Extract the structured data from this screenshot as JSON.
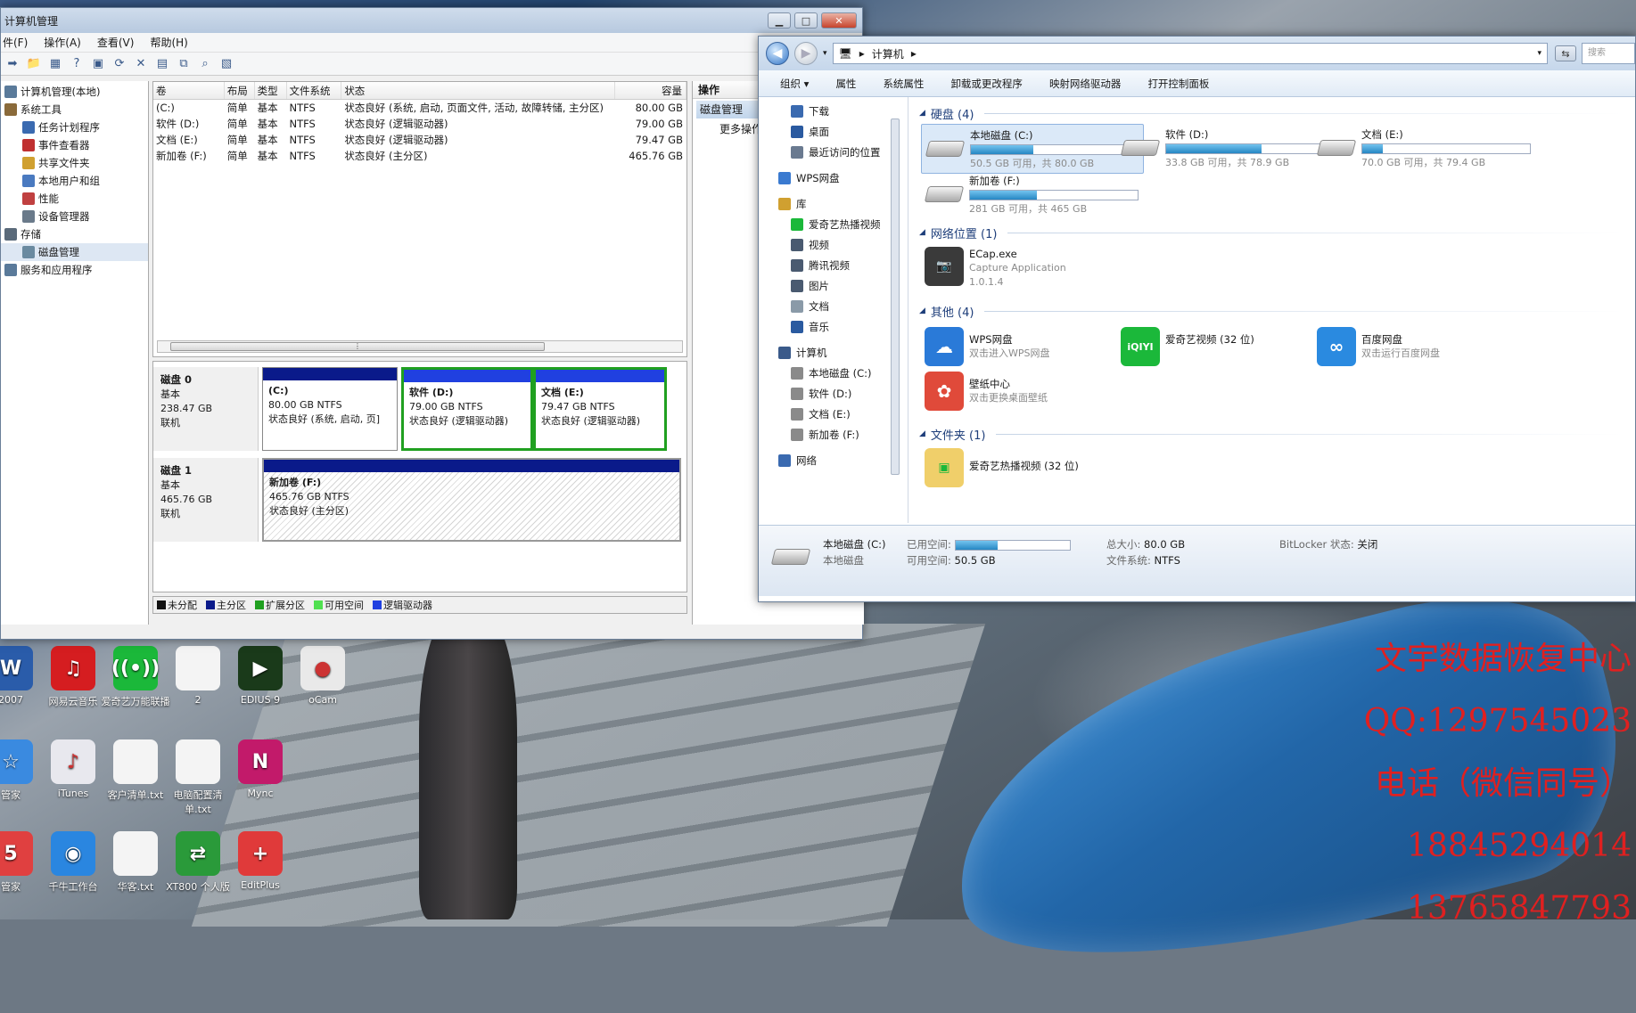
{
  "desktop": {
    "watermark": [
      "文宇数据恢复中心",
      "QQ:1297545023",
      "电话（微信同号）",
      "18845294014",
      "13765847793"
    ],
    "icons": [
      {
        "label": "2007",
        "icon": "word-icon",
        "color": "#2a5caa",
        "glyph": "W"
      },
      {
        "label": "网易云音乐",
        "icon": "netease-music-icon",
        "color": "#d51d20",
        "glyph": "♫"
      },
      {
        "label": "爱奇艺万能联播",
        "icon": "iqiyi-cast-icon",
        "color": "#1bb83a",
        "glyph": "((•))"
      },
      {
        "label": "2",
        "icon": "blank-file-icon",
        "color": "#f4f4f4",
        "glyph": ""
      },
      {
        "label": "EDIUS 9",
        "icon": "edius-icon",
        "color": "#1a3a1a",
        "glyph": "▶"
      },
      {
        "label": "oCam",
        "icon": "ocam-icon",
        "color": "#e9e9e9",
        "glyph": "●"
      },
      {
        "label": "管家",
        "icon": "manager-icon",
        "color": "#3a8ae0",
        "glyph": "☆"
      },
      {
        "label": "iTunes",
        "icon": "itunes-icon",
        "color": "#e8e8ee",
        "glyph": "♪"
      },
      {
        "label": "客户清单.txt",
        "icon": "txt-file-icon",
        "color": "#f4f4f4",
        "glyph": ""
      },
      {
        "label": "电脑配置清单.txt",
        "icon": "txt-file-icon",
        "color": "#f4f4f4",
        "glyph": ""
      },
      {
        "label": "Mync",
        "icon": "mync-icon",
        "color": "#c21a6a",
        "glyph": "N"
      },
      {
        "label": "管家",
        "icon": "tencent-manager-icon",
        "color": "#e04040",
        "glyph": "5"
      },
      {
        "label": "千牛工作台",
        "icon": "qianniu-icon",
        "color": "#2a86e0",
        "glyph": "◉"
      },
      {
        "label": "华客.txt",
        "icon": "txt-file-icon",
        "color": "#f4f4f4",
        "glyph": ""
      },
      {
        "label": "XT800 个人版",
        "icon": "xt800-icon",
        "color": "#2a9a3a",
        "glyph": "⇄"
      },
      {
        "label": "EditPlus",
        "icon": "editplus-icon",
        "color": "#e03a3a",
        "glyph": "+"
      }
    ]
  },
  "cm": {
    "title": "计算机管理",
    "menu": [
      "件(F)",
      "操作(A)",
      "查看(V)",
      "帮助(H)"
    ],
    "tree": [
      {
        "label": "计算机管理(本地)",
        "indent": 0
      },
      {
        "label": "系统工具",
        "indent": 0
      },
      {
        "label": "任务计划程序",
        "indent": 1
      },
      {
        "label": "事件查看器",
        "indent": 1
      },
      {
        "label": "共享文件夹",
        "indent": 1
      },
      {
        "label": "本地用户和组",
        "indent": 1
      },
      {
        "label": "性能",
        "indent": 1
      },
      {
        "label": "设备管理器",
        "indent": 1
      },
      {
        "label": "存储",
        "indent": 0
      },
      {
        "label": "磁盘管理",
        "indent": 1
      },
      {
        "label": "服务和应用程序",
        "indent": 0
      }
    ],
    "columns": [
      "卷",
      "布局",
      "类型",
      "文件系统",
      "状态",
      "容量"
    ],
    "volumes": [
      [
        "(C:)",
        "简单",
        "基本",
        "NTFS",
        "状态良好 (系统, 启动, 页面文件, 活动, 故障转储, 主分区)",
        "80.00 GB"
      ],
      [
        "软件 (D:)",
        "简单",
        "基本",
        "NTFS",
        "状态良好 (逻辑驱动器)",
        "79.00 GB"
      ],
      [
        "文档 (E:)",
        "简单",
        "基本",
        "NTFS",
        "状态良好 (逻辑驱动器)",
        "79.47 GB"
      ],
      [
        "新加卷 (F:)",
        "简单",
        "基本",
        "NTFS",
        "状态良好 (主分区)",
        "465.76 GB"
      ]
    ],
    "actions": {
      "header": "操作",
      "item": "磁盘管理",
      "more": "更多操作"
    },
    "disk0": {
      "name": "磁盘 0",
      "type": "基本",
      "size": "238.47 GB",
      "status": "联机",
      "parts": [
        {
          "name": "(C:)",
          "size": "80.00 GB NTFS",
          "status": "状态良好 (系统, 启动, 页]"
        },
        {
          "name": "软件  (D:)",
          "size": "79.00 GB NTFS",
          "status": "状态良好 (逻辑驱动器)"
        },
        {
          "name": "文档  (E:)",
          "size": "79.47 GB NTFS",
          "status": "状态良好 (逻辑驱动器)"
        }
      ]
    },
    "disk1": {
      "name": "磁盘 1",
      "type": "基本",
      "size": "465.76 GB",
      "status": "联机",
      "part": {
        "name": "新加卷  (F:)",
        "size": "465.76 GB NTFS",
        "status": "状态良好 (主分区)"
      }
    },
    "legend": [
      {
        "label": "未分配",
        "color": "#111111"
      },
      {
        "label": "主分区",
        "color": "#0a1a8a"
      },
      {
        "label": "扩展分区",
        "color": "#20a020"
      },
      {
        "label": "可用空间",
        "color": "#50e050"
      },
      {
        "label": "逻辑驱动器",
        "color": "#2040e0"
      }
    ]
  },
  "ex": {
    "path": "计算机",
    "search_placeholder": "搜索",
    "commands": [
      "组织 ▾",
      "属性",
      "系统属性",
      "卸载或更改程序",
      "映射网络驱动器",
      "打开控制面板"
    ],
    "nav": [
      {
        "label": "下载",
        "icon": "download-folder-icon",
        "color": "#3a6ab0",
        "grp": false
      },
      {
        "label": "桌面",
        "icon": "desktop-icon",
        "color": "#2a5aa0",
        "grp": false
      },
      {
        "label": "最近访问的位置",
        "icon": "recent-places-icon",
        "color": "#6a7a90",
        "grp": false
      },
      {
        "label": "WPS网盘",
        "icon": "wps-cloud-icon",
        "color": "#3a7ad0",
        "grp": true
      },
      {
        "label": "库",
        "icon": "library-icon",
        "color": "#d0a030",
        "grp": true
      },
      {
        "label": "爱奇艺热播视频",
        "icon": "iqiyi-icon",
        "color": "#1bb83a",
        "grp": false
      },
      {
        "label": "视频",
        "icon": "video-library-icon",
        "color": "#4a5a70",
        "grp": false
      },
      {
        "label": "腾讯视频",
        "icon": "tencent-video-icon",
        "color": "#4a5a70",
        "grp": false
      },
      {
        "label": "图片",
        "icon": "pictures-library-icon",
        "color": "#4a5a70",
        "grp": false
      },
      {
        "label": "文档",
        "icon": "documents-library-icon",
        "color": "#8a9aa8",
        "grp": false
      },
      {
        "label": "音乐",
        "icon": "music-library-icon",
        "color": "#2a5aa0",
        "grp": false
      },
      {
        "label": "计算机",
        "icon": "computer-icon",
        "color": "#3a5a8a",
        "grp": true
      },
      {
        "label": "本地磁盘 (C:)",
        "icon": "drive-c-icon",
        "color": "#8a8a8a",
        "grp": false
      },
      {
        "label": "软件 (D:)",
        "icon": "drive-icon",
        "color": "#8a8a8a",
        "grp": false
      },
      {
        "label": "文档 (E:)",
        "icon": "drive-icon",
        "color": "#8a8a8a",
        "grp": false
      },
      {
        "label": "新加卷 (F:)",
        "icon": "drive-icon",
        "color": "#8a8a8a",
        "grp": false
      },
      {
        "label": "网络",
        "icon": "network-icon",
        "color": "#3a6ab0",
        "grp": true
      }
    ],
    "sections": {
      "hard": "硬盘 (4)",
      "net": "网络位置 (1)",
      "other": "其他 (4)",
      "folder": "文件夹 (1)"
    },
    "drives": [
      {
        "name": "本地磁盘 (C:)",
        "free": "50.5 GB 可用，共 80.0 GB",
        "used_fraction": 0.37,
        "selected": true
      },
      {
        "name": "软件 (D:)",
        "free": "33.8 GB 可用，共 78.9 GB",
        "used_fraction": 0.57,
        "selected": false
      },
      {
        "name": "文档 (E:)",
        "free": "70.0 GB 可用，共 79.4 GB",
        "used_fraction": 0.12,
        "selected": false
      },
      {
        "name": "新加卷 (F:)",
        "free": "281 GB 可用，共 465 GB",
        "used_fraction": 0.4,
        "selected": false
      }
    ],
    "netloc": {
      "name": "ECap.exe",
      "desc": "Capture Application",
      "ver": "1.0.1.4"
    },
    "others": [
      {
        "name": "WPS网盘",
        "desc": "双击进入WPS网盘",
        "icon": "wps-cloud-icon",
        "color": "#2a7ad8",
        "glyph": "☁"
      },
      {
        "name": "爱奇艺视频 (32 位)",
        "desc": "",
        "icon": "iqiyi-icon",
        "color": "#1bb83a",
        "glyph": "iQIYI"
      },
      {
        "name": "百度网盘",
        "desc": "双击运行百度网盘",
        "icon": "baidu-netdisk-icon",
        "color": "#2a8ae0",
        "glyph": "∞"
      },
      {
        "name": "壁纸中心",
        "desc": "双击更换桌面壁纸",
        "icon": "wallpaper-center-icon",
        "color": "#e04a3a",
        "glyph": "✿"
      }
    ],
    "folder": {
      "name": "爱奇艺热播视频 (32 位)"
    },
    "details": {
      "name": "本地磁盘 (C:)",
      "kind": "本地磁盘",
      "used_label": "已用空间:",
      "used_fraction": 0.37,
      "free_label": "可用空间:",
      "free": "50.5 GB",
      "total_label": "总大小:",
      "total": "80.0 GB",
      "fs_label": "文件系统:",
      "fs": "NTFS",
      "bitlocker_label": "BitLocker 状态:",
      "bitlocker": "关闭"
    }
  }
}
